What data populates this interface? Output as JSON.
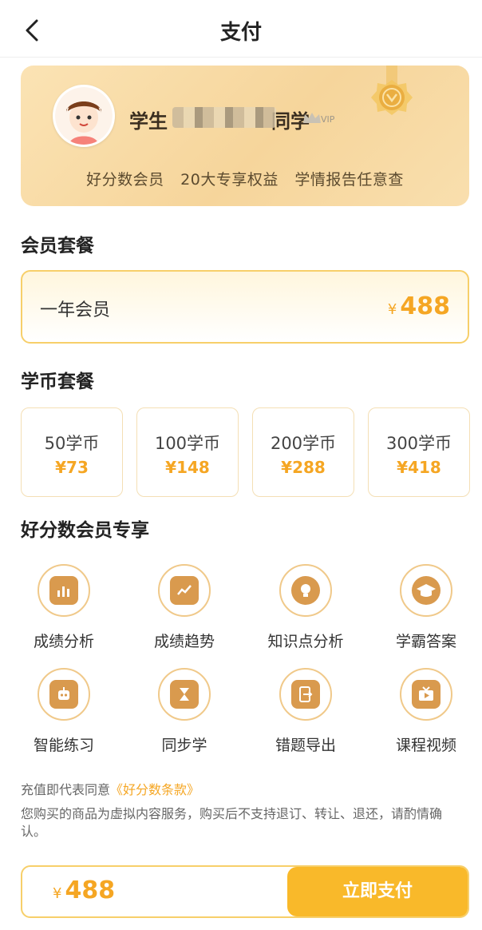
{
  "header": {
    "title": "支付"
  },
  "member": {
    "name_prefix": "学生",
    "name_suffix": "同学",
    "vip_badge": "VIP",
    "perks": [
      "好分数会员",
      "20大专享权益",
      "学情报告任意查"
    ],
    "icons": {
      "avatar": "student-avatar",
      "medal": "medal-icon",
      "vip": "crown-vip-icon"
    }
  },
  "sections": {
    "plan_title": "会员套餐",
    "coin_title": "学币套餐",
    "feature_title": "好分数会员专享"
  },
  "plan": {
    "name": "一年会员",
    "currency": "¥",
    "price": "488"
  },
  "coins": [
    {
      "label": "50学币",
      "price": "¥73"
    },
    {
      "label": "100学币",
      "price": "¥148"
    },
    {
      "label": "200学币",
      "price": "¥288"
    },
    {
      "label": "300学币",
      "price": "¥418"
    }
  ],
  "features": [
    {
      "label": "成绩分析",
      "icon": "bar-chart-icon"
    },
    {
      "label": "成绩趋势",
      "icon": "trend-chart-icon"
    },
    {
      "label": "知识点分析",
      "icon": "lightbulb-icon"
    },
    {
      "label": "学霸答案",
      "icon": "graduation-cap-icon"
    },
    {
      "label": "智能练习",
      "icon": "robot-icon"
    },
    {
      "label": "同步学",
      "icon": "hourglass-icon"
    },
    {
      "label": "错题导出",
      "icon": "export-icon"
    },
    {
      "label": "课程视频",
      "icon": "tv-play-icon"
    }
  ],
  "terms": {
    "prefix": "充值即代表同意",
    "link": "《好分数条款》",
    "notice": "您购买的商品为虚拟内容服务，购买后不支持退订、转让、退还，请酌情确认。"
  },
  "footer": {
    "currency": "¥",
    "total": "488",
    "pay_label": "立即支付"
  },
  "colors": {
    "accent": "#f9b92a",
    "price": "#f5a623",
    "card": "#f6d59b"
  }
}
